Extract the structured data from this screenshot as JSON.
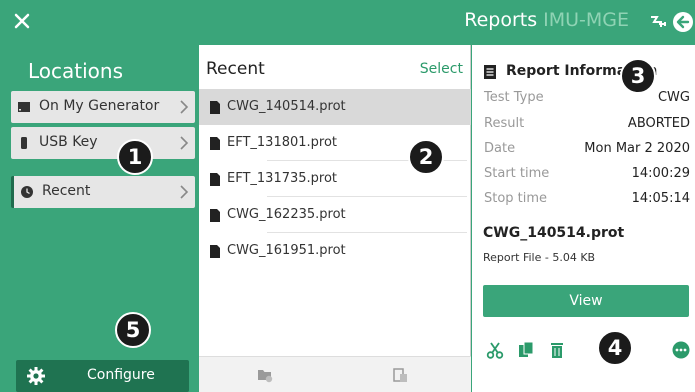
{
  "header": {
    "title": "Reports",
    "subtitle": "IMU-MGE"
  },
  "locations": {
    "title": "Locations",
    "items": [
      {
        "label": "On My Generator",
        "icon": "hard-drive-icon"
      },
      {
        "label": "USB Key",
        "icon": "usb-key-icon"
      },
      {
        "label": "Recent",
        "icon": "clock-icon"
      }
    ],
    "configure_label": "Configure"
  },
  "recent": {
    "title": "Recent",
    "select_label": "Select",
    "files": [
      "CWG_140514.prot",
      "EFT_131801.prot",
      "EFT_131735.prot",
      "CWG_162235.prot",
      "CWG_161951.prot"
    ]
  },
  "report": {
    "title": "Report Information",
    "fields": [
      {
        "key": "Test Type",
        "value": "CWG"
      },
      {
        "key": "Result",
        "value": "ABORTED"
      },
      {
        "key": "Date",
        "value": "Mon Mar 2 2020"
      },
      {
        "key": "Start time",
        "value": "14:00:29"
      },
      {
        "key": "Stop time",
        "value": "14:05:14"
      }
    ],
    "file_name": "CWG_140514.prot",
    "file_info": "Report File - 5.04 KB",
    "view_label": "View"
  },
  "callouts": [
    "1",
    "2",
    "3",
    "4",
    "5"
  ],
  "colors": {
    "accent": "#3aa57a",
    "dark_accent": "#1f7351"
  }
}
